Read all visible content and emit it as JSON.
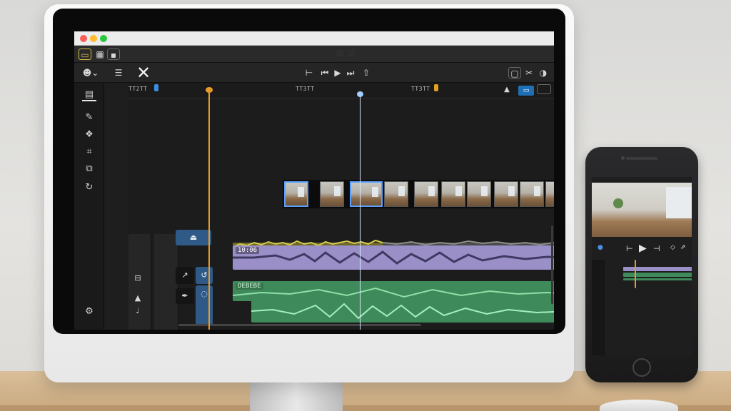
{
  "editor": {
    "titlebar_title": "",
    "toolbar1": {
      "icons": [
        "timeline-view-icon",
        "grid-icon",
        "library-icon"
      ]
    },
    "toolbar2": {
      "center_label": "▤ ▥",
      "icons": [
        "emoji-icon",
        "list-icon",
        "close-icon",
        "markers-icon",
        "skip-back-icon",
        "play-icon",
        "skip-forward-icon",
        "export-icon",
        "snapshot-icon",
        "cut-icon",
        "share-icon",
        "warning-icon",
        "layout-icon",
        "fullscreen-icon"
      ]
    },
    "sidebar": {
      "icons": [
        "inspector-icon",
        "pen-icon",
        "color-icon",
        "crop-icon",
        "transform-icon",
        "speed-icon"
      ]
    },
    "ruler": {
      "labels": [
        "TT2TT",
        "TT3TT",
        "TT3TT"
      ]
    },
    "tracks": {
      "purple_label": "10:06",
      "green_label": "DEBEBE"
    }
  },
  "phone": {
    "controls": [
      "⊢",
      "▶",
      "⊣"
    ]
  },
  "colors": {
    "accent_blue": "#1f6fb5",
    "playhead_orange": "#e69a2a",
    "audio_purple": "#9b8fc8",
    "audio_green": "#3f8a5a",
    "audio_yellow": "#c9c24a"
  }
}
